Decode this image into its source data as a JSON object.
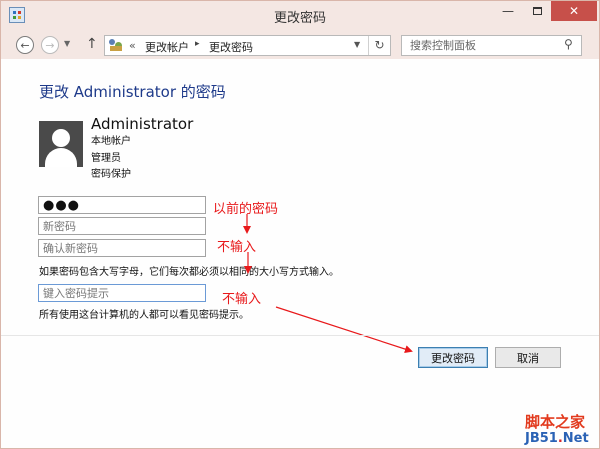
{
  "window": {
    "title": "更改密码",
    "minimize_glyph": "—",
    "close_glyph": "✕"
  },
  "navbar": {
    "back_glyph": "←",
    "forward_glyph": "→",
    "recent_glyph": "▼",
    "up_glyph": "↑",
    "breadcrumb_prefix": "«",
    "breadcrumb": [
      "更改帐户",
      "更改密码"
    ],
    "breadcrumb_separator": "▸",
    "dropdown_glyph": "▼",
    "refresh_glyph": "↻",
    "search_placeholder": "搜索控制面板",
    "search_icon_glyph": "⚲"
  },
  "main": {
    "heading": "更改 Administrator 的密码",
    "user": {
      "name": "Administrator",
      "details": [
        "本地帐户",
        "管理员",
        "密码保护"
      ]
    },
    "fields": {
      "current_password_value": "●●●",
      "new_password_placeholder": "新密码",
      "confirm_password_placeholder": "确认新密码",
      "hint_placeholder": "键入密码提示"
    },
    "case_note": "如果密码包含大写字母，它们每次都必须以相同的大小写方式输入。",
    "hint_note": "所有使用这台计算机的人都可以看见密码提示。"
  },
  "annotations": {
    "color": "#e8191b",
    "labels": [
      "以前的密码",
      "不输入",
      "不输入"
    ]
  },
  "buttons": {
    "change_password": "更改密码",
    "cancel": "取消"
  },
  "watermark": {
    "line1": "脚本之家",
    "line2_a": "JB51",
    "line2_b": ".",
    "line2_c": "Net"
  },
  "colors": {
    "titlebar": "#f4e7e3",
    "heading": "#1e3a8a",
    "close_button": "#c7504a"
  }
}
